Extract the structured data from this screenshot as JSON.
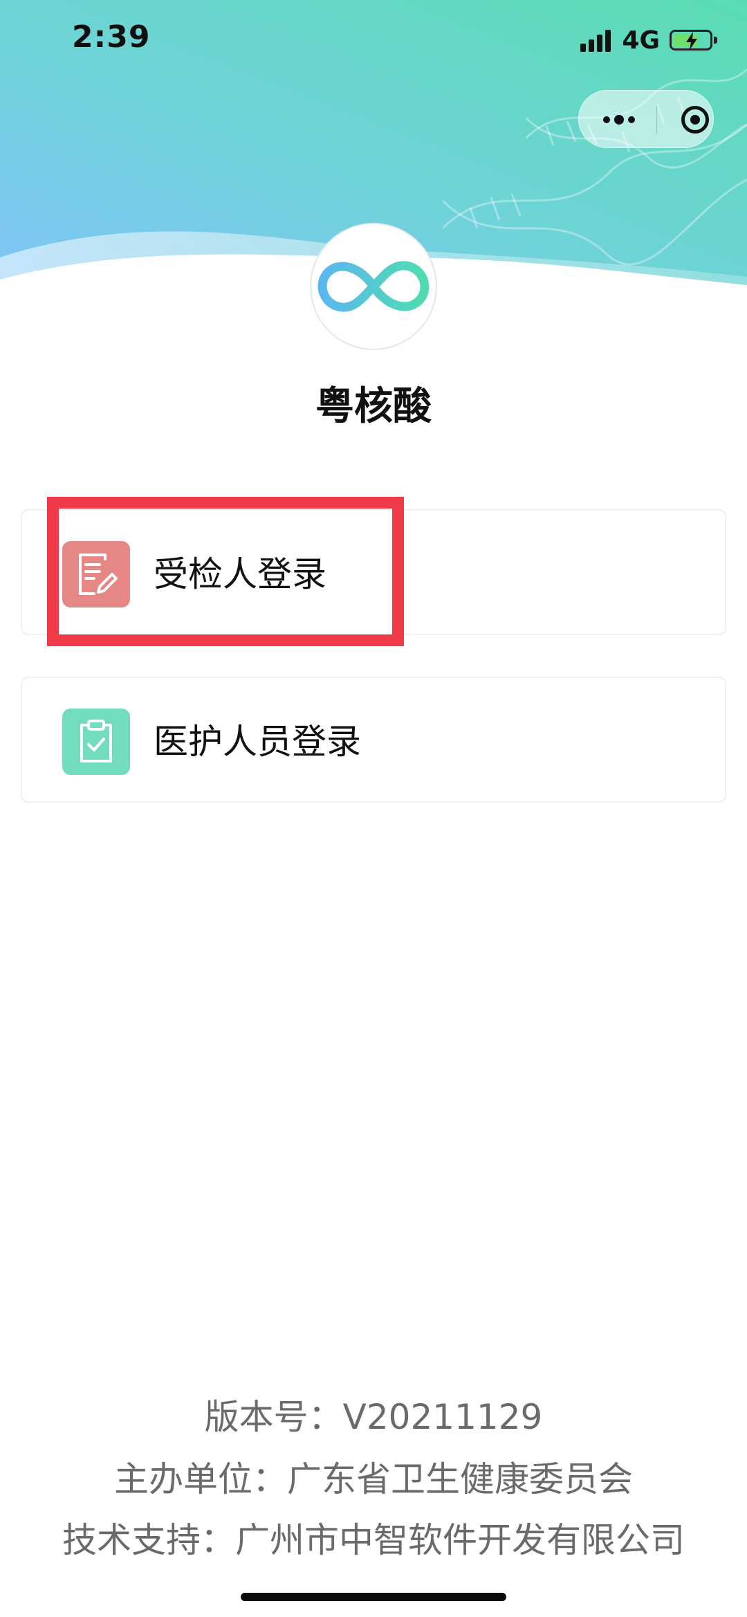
{
  "status_bar": {
    "time": "2:39",
    "network": "4G",
    "battery_level": 0.6,
    "battery_charging": true,
    "signal_bars": 4
  },
  "capsule": {
    "more_icon": "more-dots-icon",
    "close_icon": "target-circle-icon"
  },
  "app": {
    "name": "粤核酸",
    "logo_icon": "dna-infinity-logo"
  },
  "login_options": [
    {
      "label": "受检人登录",
      "icon": "form-edit-icon",
      "color": "#e58784",
      "highlighted": true
    },
    {
      "label": "医护人员登录",
      "icon": "clipboard-check-icon",
      "color": "#74dcbe",
      "highlighted": false
    }
  ],
  "footer": {
    "version": "版本号：V20211129",
    "organizer": "主办单位：广东省卫生健康委员会",
    "tech_support": "技术支持：广州市中智软件开发有限公司"
  },
  "colors": {
    "banner_left": "#7ec3f7",
    "banner_right": "#5ddcb6",
    "highlight": "#ef3b48"
  }
}
